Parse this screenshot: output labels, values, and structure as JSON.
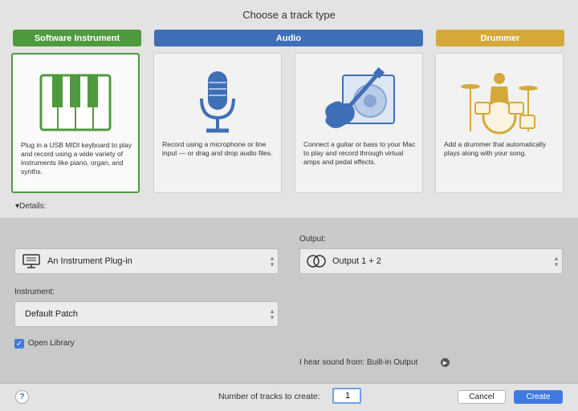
{
  "dialog": {
    "title": "Choose a track type"
  },
  "categories": {
    "software_instrument": "Software Instrument",
    "audio": "Audio",
    "drummer": "Drummer"
  },
  "cards": [
    {
      "icon": "piano-keyboard-icon",
      "desc": "Plug in a USB MIDI keyboard to play and record using a wide variety of instruments like piano, organ, and synths."
    },
    {
      "icon": "microphone-icon",
      "desc": "Record using a microphone or line input — or drag and drop audio files."
    },
    {
      "icon": "guitar-icon",
      "desc": "Connect a guitar or bass to your Mac to play and record through virtual amps and pedal effects."
    },
    {
      "icon": "drum-kit-icon",
      "desc": "Add a drummer that automatically plays along with your song."
    }
  ],
  "details": {
    "label": "Details:"
  },
  "input": {
    "value": "An Instrument Plug-in"
  },
  "output": {
    "label": "Output:",
    "value": "Output 1 + 2"
  },
  "instrument": {
    "label": "Instrument:",
    "value": "Default Patch"
  },
  "open_library": {
    "label": "Open Library",
    "checked": true
  },
  "hear_sound": "I hear sound from: Built-in Output",
  "footer": {
    "help": "?",
    "tracks_label": "Number of tracks to create:",
    "tracks_value": "1",
    "cancel": "Cancel",
    "create": "Create"
  },
  "colors": {
    "software": "#4f9a3f",
    "audio": "#3f6fb6",
    "drummer": "#d4a93a",
    "create": "#3f7ae0"
  }
}
